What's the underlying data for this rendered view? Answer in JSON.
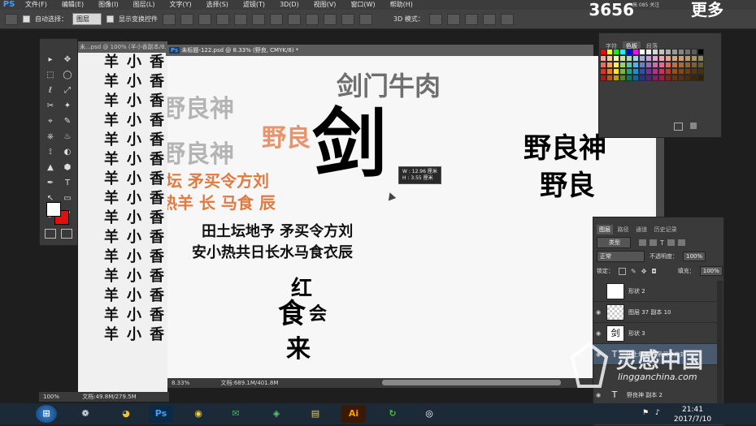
{
  "menubar": {
    "logo": "PS",
    "items": [
      "文件(F)",
      "编辑(E)",
      "图像(I)",
      "图层(L)",
      "文字(Y)",
      "选择(S)",
      "滤镜(T)",
      "3D(D)",
      "视图(V)",
      "窗口(W)",
      "帮助(H)"
    ]
  },
  "brand_overlay": {
    "number": "3656",
    "tail": "更多",
    "small_text": "高 085 关注"
  },
  "options_bar": {
    "auto_select_label": "自动选择：",
    "auto_select_value": "图层",
    "show_transform_label": "显示变换控件",
    "mode_3d_label": "3D 模式："
  },
  "tools": {
    "items": [
      "▸",
      "✥",
      "⬚",
      "◯",
      "ℓ",
      "⤢",
      "✂",
      "✦",
      "⌖",
      "✎",
      "⎈",
      "♨",
      "⟟",
      "◐",
      "▲",
      "⬢",
      "✒",
      "T",
      "↖",
      "▭",
      "✋",
      "⚲"
    ]
  },
  "bg_document": {
    "tab_title": "未...psd @ 100% (羊小香副本/8...",
    "columns": {
      "col1": [
        "羊",
        "羊",
        "羊",
        "羊",
        "羊",
        "羊",
        "羊",
        "羊",
        "羊",
        "羊",
        "羊",
        "羊",
        "羊",
        "羊",
        "羊"
      ],
      "col2": [
        "小",
        "小",
        "小",
        "小",
        "小",
        "小",
        "小",
        "小",
        "小",
        "小",
        "小",
        "小",
        "小",
        "小",
        "小"
      ],
      "col3": [
        "香",
        "香",
        "香",
        "香",
        "香",
        "香",
        "香",
        "香",
        "香",
        "香",
        "香",
        "香",
        "香",
        "香",
        "香"
      ]
    },
    "status": {
      "zoom": "100%",
      "doc_info": "文档:49.8M/279.5M"
    }
  },
  "main_document": {
    "tab_badge": "Ps",
    "tab_title": "未标题-122.psd @ 8.33% (野良, CMYK/8) *",
    "status": {
      "zoom": "8.33%",
      "doc_info": "文档:689.1M/401.8M"
    },
    "canvas": {
      "title_text": "剑门牛肉",
      "big_char": "剑",
      "grey_line1": "野良神",
      "grey_line2": "野良神",
      "orange_small": "野良",
      "orange_line1": "坛  矛买令方刘",
      "orange_line2": "热羊  长  马食  辰",
      "black_line1": "田土坛地予 矛买令方刘",
      "black_line2": "安小热共日长水马食衣辰",
      "stamp_chars": [
        "红",
        "食",
        "会",
        "来"
      ],
      "right_line1": "野良神",
      "right_line2": "野良",
      "tooltip": {
        "w": "W : 12.96 厘米",
        "h": "H :  3.55 厘米"
      }
    }
  },
  "color_panel": {
    "tabs": [
      "字符",
      "色板",
      "段落"
    ],
    "active_tab": "色板",
    "swatches": [
      "#ff0000",
      "#ffff00",
      "#00ff00",
      "#00ffff",
      "#0000ff",
      "#ff00ff",
      "#ffffff",
      "#ebebeb",
      "#d6d6d6",
      "#c2c2c2",
      "#adadad",
      "#999999",
      "#858585",
      "#707070",
      "#5c5c5c",
      "#000000",
      "#f4a9a3",
      "#f9c99e",
      "#fff5a3",
      "#c7e6a3",
      "#a3d9c7",
      "#a3cff2",
      "#a3aee0",
      "#c2a3d9",
      "#e3a3cf",
      "#f2a3b8",
      "#e8a38f",
      "#dba37a",
      "#c99e72",
      "#b8996b",
      "#a39466",
      "#8f8a5e",
      "#ed6b5e",
      "#f5a356",
      "#ffee5c",
      "#9ed16b",
      "#5cc2a3",
      "#5cb0eb",
      "#6b7ecc",
      "#9e6bc2",
      "#cf6bb0",
      "#e66b8a",
      "#d6705c",
      "#c2703d",
      "#a86b3d",
      "#8f6638",
      "#7a6138",
      "#665c33",
      "#e8301c",
      "#f07d1a",
      "#fce51a",
      "#73bd33",
      "#1aa88a",
      "#1a8fe0",
      "#2e4db8",
      "#7a2ea8",
      "#b82e8f",
      "#d62e5c",
      "#b83d26",
      "#9e4d14",
      "#854714",
      "#6b4214",
      "#57380f",
      "#47330a",
      "#a81f12",
      "#b35c0f",
      "#b8a30f",
      "#4f8a1f",
      "#0f7a63",
      "#0f66a3",
      "#1f3885",
      "#57217a",
      "#851f66",
      "#9e1f40",
      "#80291a",
      "#6b330a",
      "#5c300a",
      "#4d2e0a",
      "#3d2605",
      "#2e2205"
    ]
  },
  "layers_panel": {
    "tabs": [
      "图层",
      "路径",
      "通道",
      "历史记录"
    ],
    "active_tab": "图层",
    "filter_label": "类型",
    "blend_mode": "正常",
    "opacity_label": "不透明度：",
    "opacity_value": "100%",
    "lock_label": "锁定：",
    "fill_label": "填充：",
    "fill_value": "100%",
    "layers": [
      {
        "name": "形状 2",
        "thumb": ""
      },
      {
        "name": "图层 37 副本 10",
        "thumb": ""
      },
      {
        "name": "形状 3",
        "thumb": "剑"
      },
      {
        "name": "田土坛地予 矛买令方刘",
        "thumb": "T"
      },
      {
        "name": "野良神 副本 2",
        "thumb": "T"
      }
    ]
  },
  "taskbar": {
    "apps": [
      "⊞",
      "❁",
      "◕",
      "Ps",
      "◉",
      "✉",
      "◈",
      "▤",
      "Ai",
      "↻",
      "◎"
    ],
    "time": "21:41",
    "date": "2017/7/10"
  },
  "watermark": {
    "cn": "灵感中国",
    "url": "lingganchina.com"
  },
  "colors": {
    "ps_blue": "#3ea0ff",
    "taskbar": "#1c2a38",
    "panel": "#3a3a3a",
    "accent_orange": "#e07a40"
  }
}
